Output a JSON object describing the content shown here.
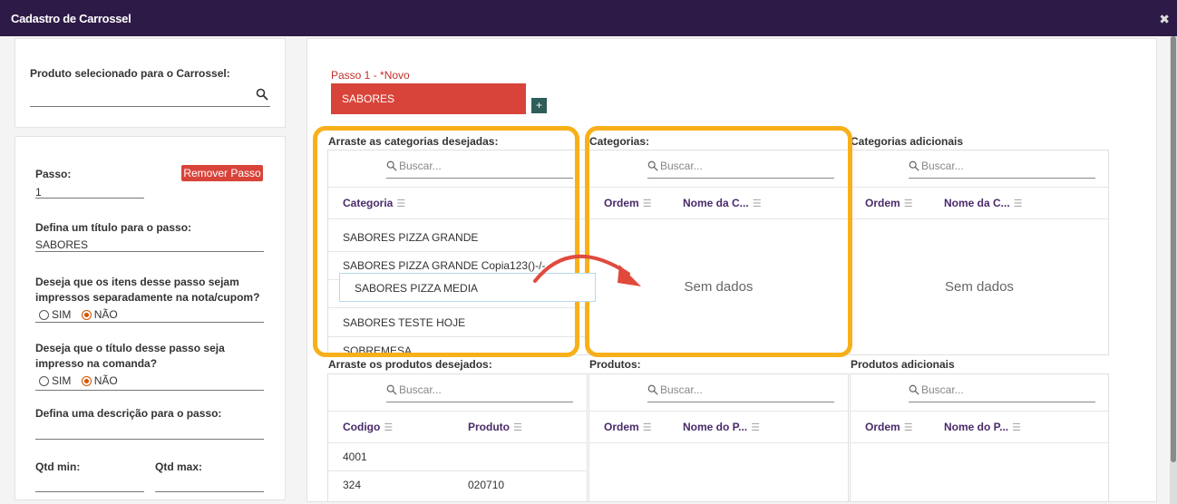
{
  "window": {
    "title": "Cadastro de Carrossel",
    "close_glyph": "✖"
  },
  "product": {
    "label": "Produto selecionado para o Carrossel:",
    "value": ""
  },
  "step_form": {
    "passo_label": "Passo:",
    "passo_value": "1",
    "remove_label": "Remover Passo",
    "title_label": "Defina um título para o passo:",
    "title_value": "SABORES",
    "print_note_q": "Deseja que os itens desse passo sejam impressos separadamente na nota/cupom?",
    "print_title_q": "Deseja que o título desse passo seja impresso na comanda?",
    "opt_sim": "SIM",
    "opt_nao": "NÃO",
    "description_label": "Defina uma descrição para o passo:",
    "qtd_min": "Qtd min:",
    "qtd_max": "Qtd max:"
  },
  "steps": {
    "label": "Passo 1 - *Novo",
    "active": "SABORES",
    "add": "+"
  },
  "search_placeholder": "Buscar...",
  "cat_source": {
    "title": "Arraste as categorias desejadas:",
    "col": "Categoria",
    "rows": [
      "SABORES PIZZA GRANDE",
      "SABORES PIZZA GRANDE Copia123()-/-",
      "",
      "SABORES TESTE HOJE",
      "SOBREMESA"
    ]
  },
  "drag_item": "SABORES PIZZA MEDIA",
  "cat_target": {
    "title": "Categorias:",
    "col_ordem": "Ordem",
    "col_nome": "Nome da C...",
    "empty": "Sem dados"
  },
  "cat_extra": {
    "title": "Categorias adicionais",
    "col_ordem": "Ordem",
    "col_nome": "Nome da C...",
    "empty": "Sem dados"
  },
  "prod_source": {
    "title": "Arraste os produtos desejados:",
    "col_codigo": "Codigo",
    "col_produto": "Produto",
    "rows": [
      {
        "codigo": "4001",
        "produto": ""
      },
      {
        "codigo": "324",
        "produto": "020710"
      }
    ]
  },
  "prod_target": {
    "title": "Produtos:",
    "col_ordem": "Ordem",
    "col_nome": "Nome do P..."
  },
  "prod_extra": {
    "title": "Produtos adicionais",
    "col_ordem": "Ordem",
    "col_nome": "Nome do P..."
  },
  "colors": {
    "header": "#2e1a47",
    "accent": "#d9443a",
    "highlight": "#f8b01a",
    "column_header": "#4a2a6a"
  },
  "icons": {
    "search": "search-icon",
    "filter": "filter-icon",
    "arrow": "curved-arrow-icon",
    "close": "close-icon"
  }
}
